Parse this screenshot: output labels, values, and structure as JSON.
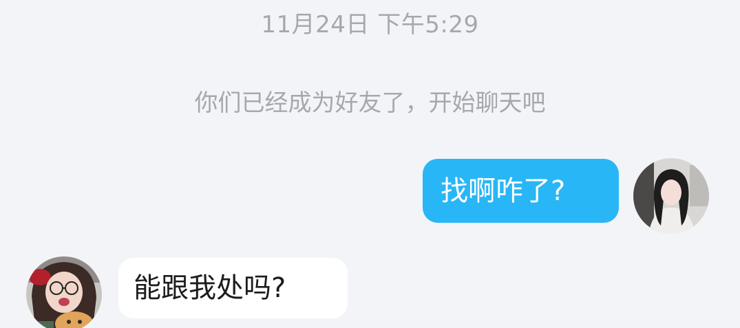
{
  "timestamp": "11月24日 下午5:29",
  "system_note": "你们已经成为好友了，开始聊天吧",
  "messages": [
    {
      "sender": "me",
      "text": "找啊咋了?"
    },
    {
      "sender": "friend",
      "text": "能跟我处吗?"
    }
  ],
  "colors": {
    "background": "#f3f4f8",
    "outgoing_bubble": "#29b6f6",
    "incoming_bubble": "#ffffff",
    "meta_text": "#a5a8ad"
  },
  "icons": {
    "my_avatar": "user-avatar-photo",
    "friend_avatar": "friend-avatar-photo"
  }
}
